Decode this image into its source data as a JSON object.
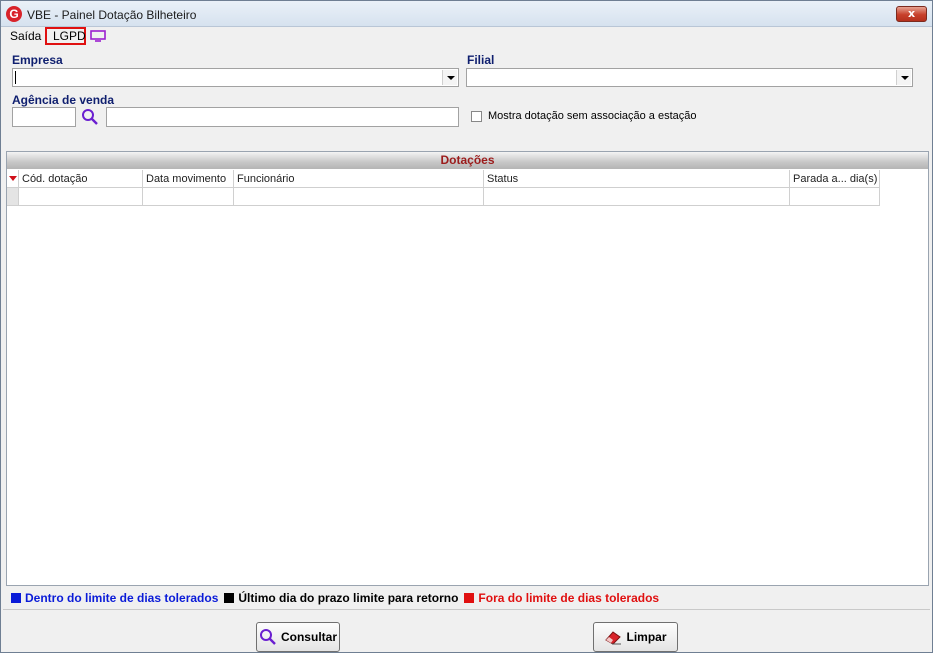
{
  "window": {
    "title": "VBE - Painel Dotação Bilheteiro",
    "app_icon_letter": "G",
    "close_label": "x"
  },
  "menu": {
    "items": [
      {
        "label": "Saída"
      },
      {
        "label": "LGPD"
      }
    ],
    "monitor_icon": "monitor-icon"
  },
  "form": {
    "empresa_label": "Empresa",
    "empresa_value": "",
    "filial_label": "Filial",
    "filial_value": "",
    "agencia_label": "Agência de venda",
    "agencia_code": "",
    "agencia_name": "",
    "checkbox_label": "Mostra dotação sem associação a estação",
    "checkbox_checked": false
  },
  "grid": {
    "title": "Dotações",
    "columns": [
      "Cód. dotação",
      "Data movimento",
      "Funcionário",
      "Status",
      "Parada a... dia(s)"
    ],
    "rows": [
      [
        "",
        "",
        "",
        "",
        ""
      ]
    ]
  },
  "legend": [
    {
      "label": "Dentro do limite de dias tolerados",
      "color": "#0a1bd8"
    },
    {
      "label": "Último dia do prazo limite para retorno",
      "color": "#000000"
    },
    {
      "label": "Fora do limite de dias tolerados",
      "color": "#e01010"
    }
  ],
  "buttons": {
    "consultar": "Consultar",
    "limpar": "Limpar"
  },
  "colors": {
    "label_blue": "#0f1f6f",
    "grid_title_red": "#9b1b1b",
    "lgpd_highlight": "#e01010"
  }
}
